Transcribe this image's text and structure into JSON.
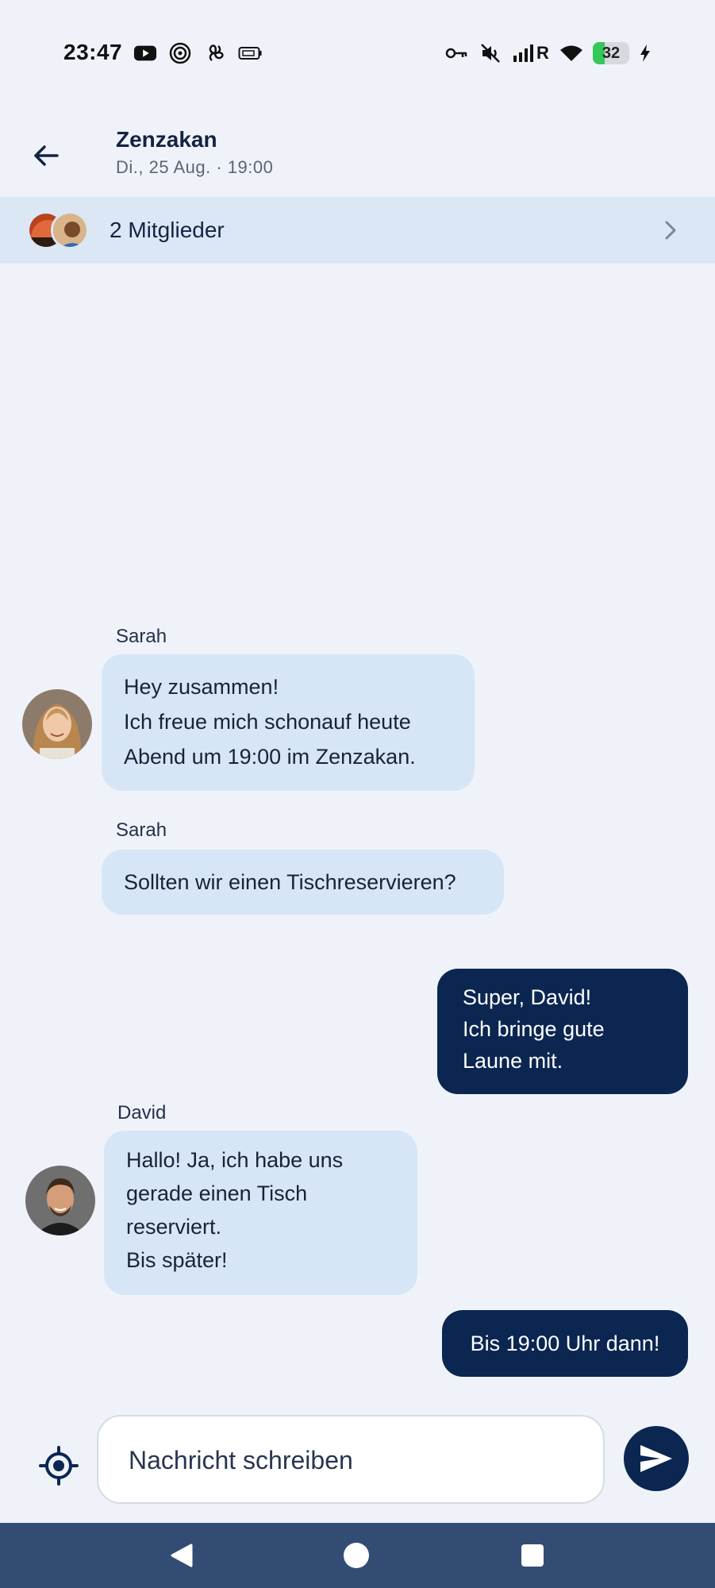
{
  "status_bar": {
    "time": "23:47",
    "left_icons": [
      "youtube-icon",
      "target-icon",
      "fan-icon",
      "battery-saver-icon"
    ],
    "right_icons": [
      "key-icon",
      "mute-icon",
      "signal-icon",
      "wifi-icon"
    ],
    "signal_label": "R",
    "battery_level": "32",
    "battery_color": "#34c759"
  },
  "header": {
    "title": "Zenzakan",
    "subtitle": "Di., 25 Aug. · 19:00"
  },
  "members": {
    "label": "2 Mitglieder"
  },
  "messages": [
    {
      "sender": "Sarah",
      "direction": "incoming",
      "lines": [
        " Hey zusammen!",
        "Ich freue mich  schonauf heute",
        "Abend um  19:00 im Zenzakan."
      ]
    },
    {
      "sender": "Sarah",
      "direction": "incoming",
      "lines": [
        "Sollten wir einen Tischreservieren?"
      ]
    },
    {
      "sender": "",
      "direction": "outgoing",
      "lines": [
        "Super, David!",
        "Ich bringe gute",
        "Laune mit."
      ]
    },
    {
      "sender": "David",
      "direction": "incoming",
      "lines": [
        "Hallo! Ja, ich habe uns",
        "gerade einen Tisch",
        "reserviert.",
        "Bis später!"
      ]
    },
    {
      "sender": "",
      "direction": "outgoing",
      "lines": [
        "Bis 19:00 Uhr dann!"
      ]
    }
  ],
  "composer": {
    "placeholder": "Nachricht schreiben"
  },
  "colors": {
    "background": "#eff3f9",
    "incoming_bubble": "#d6e6f7",
    "outgoing_bubble": "#0c2652",
    "members_bar": "#dbe7f5",
    "nav_bar": "#334c73"
  }
}
